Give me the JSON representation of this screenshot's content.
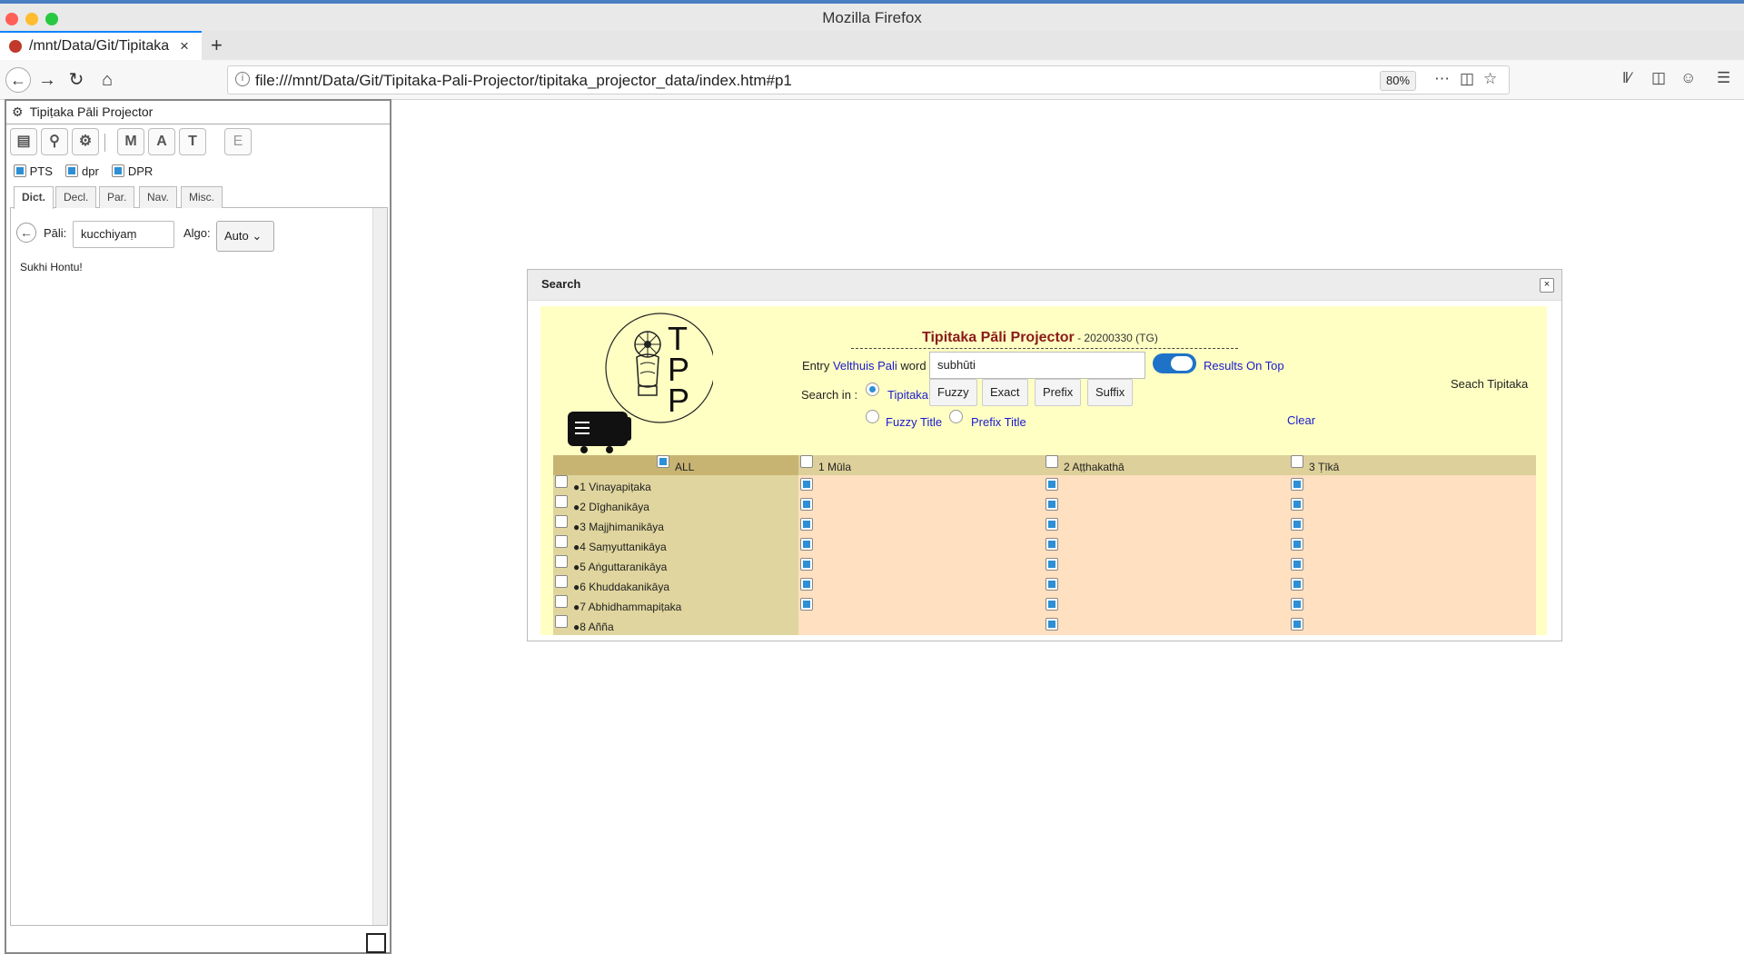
{
  "window": {
    "title": "Mozilla Firefox"
  },
  "tab": {
    "label": "/mnt/Data/Git/Tipitaka",
    "close": "×",
    "new": "+"
  },
  "nav": {
    "url": "file:///mnt/Data/Git/Tipitaka-Pali-Projector/tipitaka_projector_data/index.htm#p1",
    "zoom": "80%"
  },
  "sidebar": {
    "title": "Tipiṭaka Pāli Projector",
    "toolbar": [
      "M",
      "A",
      "T",
      "E"
    ],
    "checks": [
      {
        "label": "PTS",
        "checked": true
      },
      {
        "label": "dpr",
        "checked": true
      },
      {
        "label": "DPR",
        "checked": true
      }
    ],
    "tabs": [
      "Dict.",
      "Decl.",
      "Par.",
      "Nav.",
      "Misc."
    ],
    "pali_label": "Pāli:",
    "pali_value": "kucchiyaṃ",
    "algo_label": "Algo:",
    "algo_value": "Auto",
    "message": "Sukhi Hontu!"
  },
  "dialog": {
    "title": "Search",
    "close": "×",
    "app_title": "Tipitaka Pāli Projector",
    "app_version": " - 20200330 (TG)",
    "entry_prefix": "Entry ",
    "entry_link": "Velthuis Pali",
    "entry_suffix": " word",
    "word_value": "subhūti",
    "results_on_top": "Results On Top",
    "search_in": "Search in :",
    "opt_tipitaka": "Tipitaka",
    "btn_fuzzy": "Fuzzy",
    "btn_exact": "Exact",
    "btn_prefix": "Prefix",
    "btn_suffix": "Suffix",
    "opt_fuzzy_title": "Fuzzy Title",
    "opt_prefix_title": "Prefix Title",
    "seach_tipitaka": "Seach Tipitaka",
    "clear": "Clear",
    "grid": {
      "all": "ALL",
      "cols": [
        "1 Mūla",
        "2 Aṭṭhakathā",
        "3 Ṭīkā"
      ],
      "rows": [
        "●1 Vinayapiṭaka",
        "●2 Dīghanikāya",
        "●3 Majjhimanikāya",
        "●4 Saṃyuttanikāya",
        "●5 Aṅguttaranikāya",
        "●6 Khuddakanikāya",
        "●7 Abhidhammapiṭaka",
        "●8 Añña"
      ]
    }
  },
  "colors": {
    "accent": "#0a84ff",
    "dialog_bg": "#ffffc4",
    "title_red": "#8b1a1a",
    "link_blue": "#1a1ad0",
    "check_blue": "#2d8fd6"
  }
}
